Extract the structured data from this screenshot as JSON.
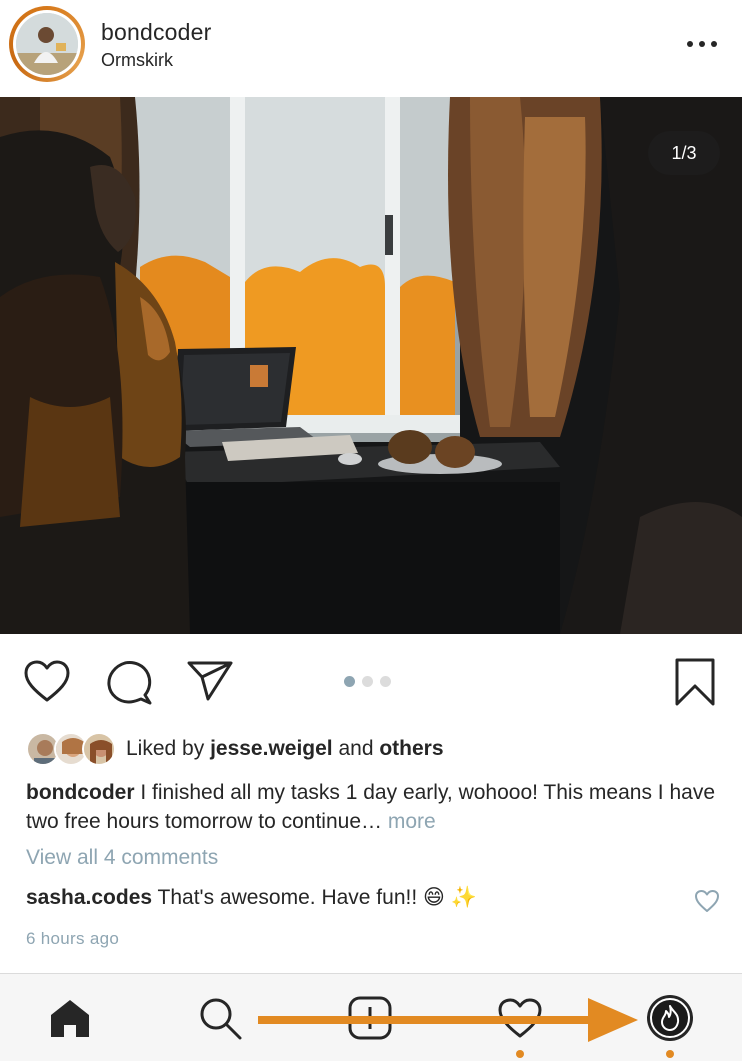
{
  "post": {
    "username": "bondcoder",
    "location": "Ormskirk",
    "image_counter": "1/3",
    "carousel": {
      "count": 3,
      "active": 0
    }
  },
  "likes": {
    "prefix": "Liked by ",
    "user": "jesse.weigel",
    "joiner": " and ",
    "others": "others"
  },
  "caption": {
    "author": "bondcoder",
    "text": " I finished all my tasks 1 day early, wohooo! This means I have two free hours tomorrow to continue… ",
    "more_label": "more"
  },
  "comments": {
    "view_all_label": "View all 4 comments",
    "top": {
      "author": "sasha.codes",
      "text": " That's awesome. Have fun!! 😄 ✨"
    }
  },
  "time_ago": "6 hours ago",
  "nav": {
    "items": [
      "home-icon",
      "search-icon",
      "add-icon",
      "heart-icon",
      "profile-icon"
    ],
    "accent_color": "#e28a22"
  },
  "icons": {
    "post_actions": [
      "heart-icon",
      "comment-icon",
      "share-icon",
      "bookmark-icon"
    ],
    "header": "more-options-icon"
  }
}
